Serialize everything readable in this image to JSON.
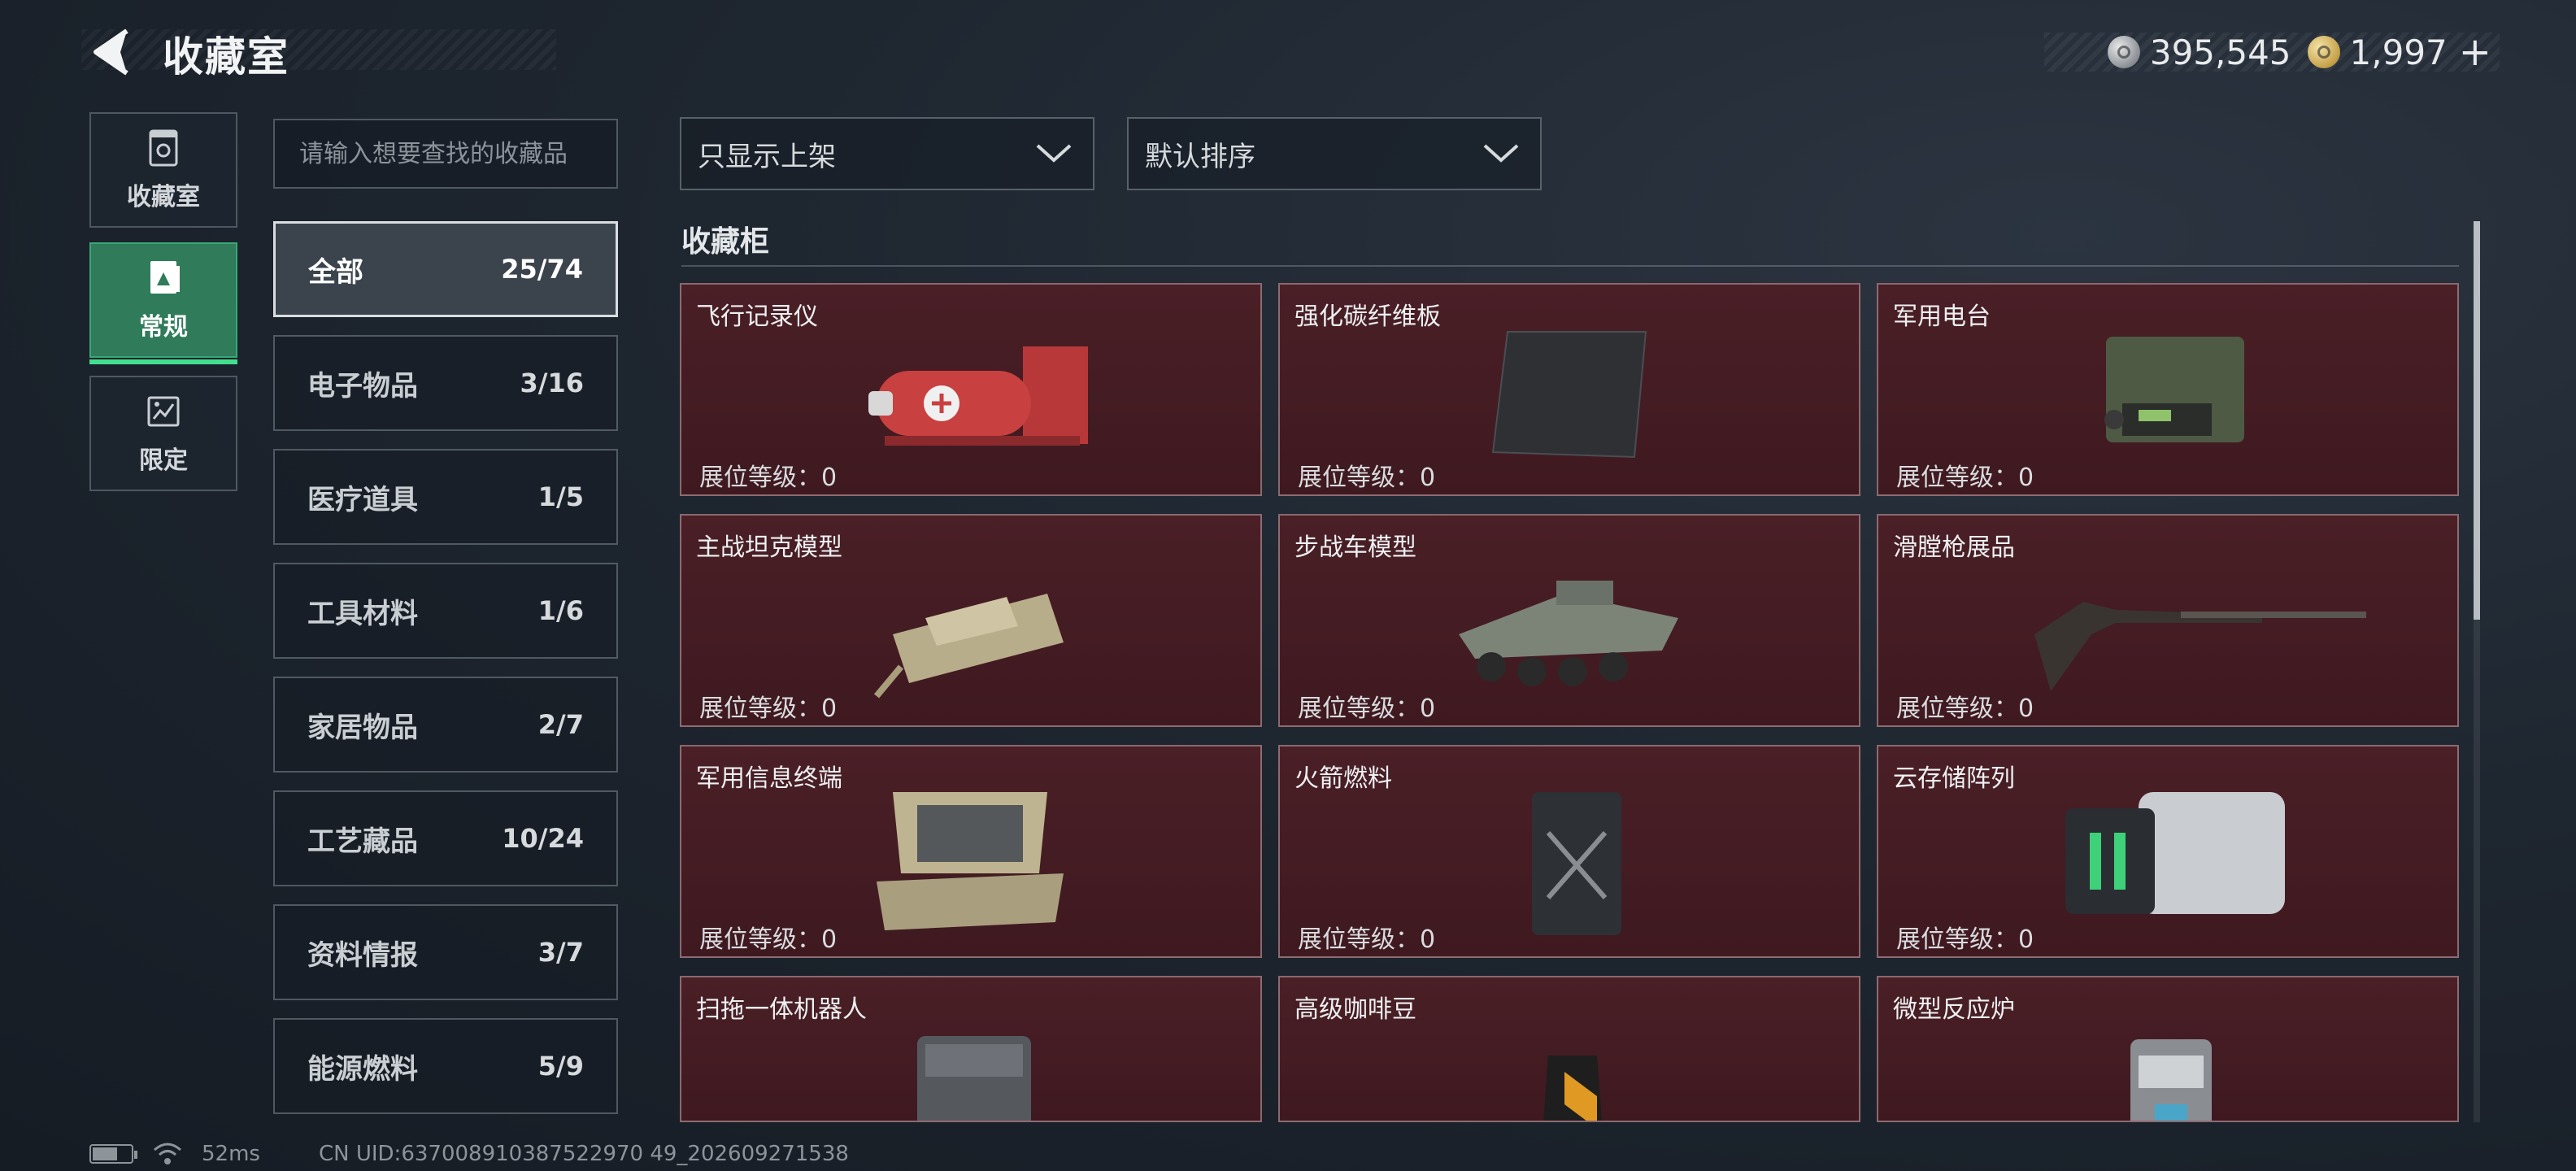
{
  "header": {
    "title": "收藏室",
    "currencies": [
      {
        "icon": "silver-coin-icon",
        "value": "395,545"
      },
      {
        "icon": "gold-coin-icon",
        "value": "1,997"
      }
    ],
    "add_label": "+"
  },
  "nav": {
    "tabs": [
      {
        "label": "收藏室",
        "icon": "collection-room-icon",
        "active": false
      },
      {
        "label": "常规",
        "icon": "regular-icon",
        "active": true
      },
      {
        "label": "限定",
        "icon": "limited-icon",
        "active": false
      }
    ]
  },
  "search": {
    "placeholder": "请输入想要查找的收藏品",
    "value": ""
  },
  "categories": [
    {
      "name": "全部",
      "count": "25/74",
      "active": true
    },
    {
      "name": "电子物品",
      "count": "3/16"
    },
    {
      "name": "医疗道具",
      "count": "1/5"
    },
    {
      "name": "工具材料",
      "count": "1/6"
    },
    {
      "name": "家居物品",
      "count": "2/7"
    },
    {
      "name": "工艺藏品",
      "count": "10/24"
    },
    {
      "name": "资料情报",
      "count": "3/7"
    },
    {
      "name": "能源燃料",
      "count": "5/9"
    }
  ],
  "filters": {
    "shelf_filter": "只显示上架",
    "sort": "默认排序"
  },
  "section_title": "收藏柜",
  "level_label": "展位等级：0",
  "items": [
    {
      "name": "飞行记录仪",
      "icon": "flight-recorder-icon"
    },
    {
      "name": "强化碳纤维板",
      "icon": "carbon-fiber-plate-icon"
    },
    {
      "name": "军用电台",
      "icon": "military-radio-icon"
    },
    {
      "name": "主战坦克模型",
      "icon": "tank-model-icon"
    },
    {
      "name": "步战车模型",
      "icon": "ifv-model-icon"
    },
    {
      "name": "滑膛枪展品",
      "icon": "musket-icon"
    },
    {
      "name": "军用信息终端",
      "icon": "military-terminal-icon"
    },
    {
      "name": "火箭燃料",
      "icon": "rocket-fuel-icon"
    },
    {
      "name": "云存储阵列",
      "icon": "cloud-storage-icon"
    },
    {
      "name": "扫拖一体机器人",
      "icon": "cleaning-robot-icon"
    },
    {
      "name": "高级咖啡豆",
      "icon": "coffee-beans-icon"
    },
    {
      "name": "微型反应炉",
      "icon": "micro-reactor-icon"
    }
  ],
  "status": {
    "ping": "52ms",
    "uid": "CN UID:637008910387522970 49_202609271538"
  }
}
